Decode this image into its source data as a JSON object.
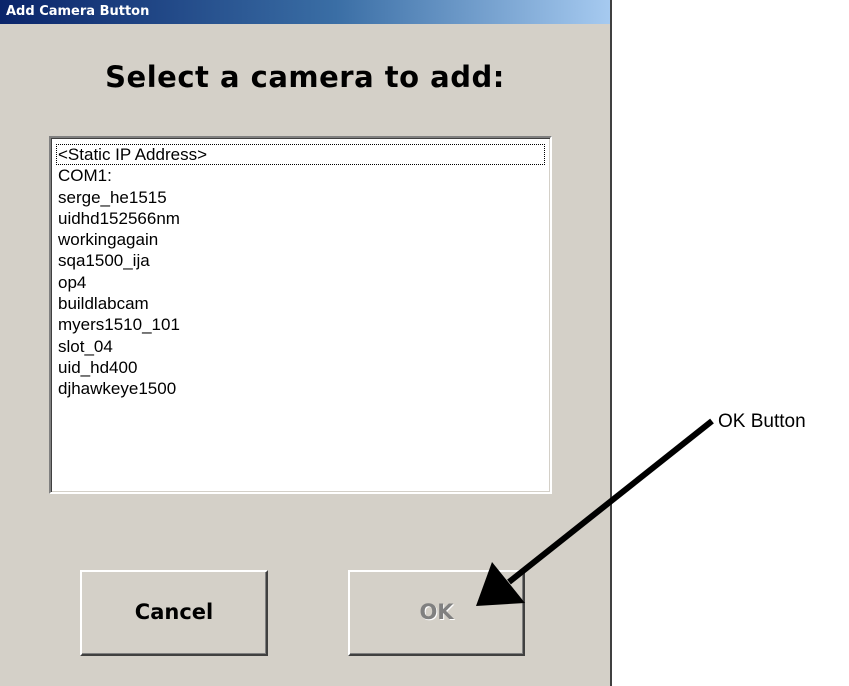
{
  "window": {
    "title": "Add Camera Button"
  },
  "dialog": {
    "heading": "Select a camera to add:",
    "camera_list": {
      "focused_index": 0,
      "items": [
        "<Static IP Address>",
        "COM1:",
        "serge_he1515",
        "uidhd152566nm",
        "workingagain",
        "sqa1500_ija",
        "op4",
        "buildlabcam",
        "myers1510_101",
        "slot_04",
        "uid_hd400",
        "djhawkeye1500"
      ]
    },
    "buttons": {
      "cancel_label": "Cancel",
      "ok_label": "OK",
      "ok_enabled": false
    }
  },
  "annotation": {
    "label": "OK Button"
  },
  "colors": {
    "dialog_bg": "#d4d0c8",
    "titlebar_start": "#0a246a",
    "titlebar_end": "#a6caf0",
    "disabled_text": "#808080"
  }
}
